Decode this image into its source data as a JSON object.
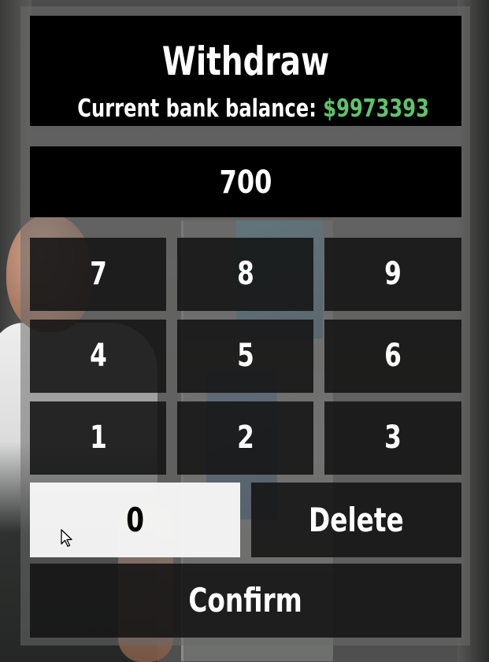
{
  "header": {
    "title": "Withdraw",
    "balance_label": "Current bank balance:",
    "balance_amount": "$9973393",
    "balance_color": "#5fc36b"
  },
  "amount_display": {
    "value": "700"
  },
  "keypad": {
    "keys": [
      "7",
      "8",
      "9",
      "4",
      "5",
      "6",
      "1",
      "2",
      "3"
    ],
    "zero_label": "0",
    "zero_state": "highlighted",
    "delete_label": "Delete",
    "confirm_label": "Confirm"
  },
  "colors": {
    "key_background": "#121212",
    "highlight_background": "#f6f6f6",
    "panel_background": "#696969",
    "text": "#ffffff"
  },
  "icons": {
    "pointer": "mouse-cursor-icon"
  }
}
